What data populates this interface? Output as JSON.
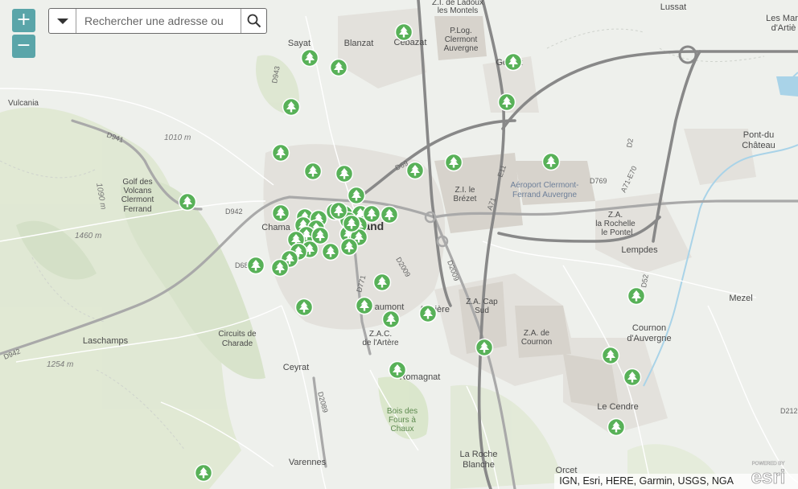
{
  "search": {
    "placeholder": "Rechercher une adresse ou"
  },
  "zoom": {
    "in_label": "+",
    "out_label": "−"
  },
  "attribution": "IGN, Esri, HERE, Garmin, USGS, NGA",
  "logo": {
    "powered_by": "POWERED BY",
    "brand": "esri"
  },
  "places": {
    "lussat": "Lussat",
    "les_martres_1": "Les Mar",
    "les_martres_2": "d'Artiè",
    "za_ladoux_1": "Z.I. de Ladoux",
    "za_ladoux_2": "les Montels",
    "plog_1": "P.Log.",
    "plog_2": "Clermont",
    "plog_3": "Auvergne",
    "sayat": "Sayat",
    "blanzat": "Blanzat",
    "cebazat": "Cébazat",
    "gerzat": "Gerzat",
    "vulcania": "Vulcania",
    "pont_chateau_1": "Pont-du",
    "pont_chateau_2": "Château",
    "golf_1": "Golf des",
    "golf_2": "Volcans",
    "golf_3": "Clermont",
    "golf_4": "Ferrand",
    "zi_brezet_1": "Z.I. le",
    "zi_brezet_2": "Brézet",
    "aero_1": "Aéroport Clermont-",
    "aero_2": "Ferrand Auvergne",
    "za_rochelle_1": "Z.A.",
    "za_rochelle_2": "la Rochelle",
    "za_rochelle_3": "le Pontel",
    "chamalieres": "Chama",
    "clermont": "rand",
    "lempdes": "Lempdes",
    "mezel": "Mezel",
    "aubiere": "Aubière",
    "beaumont": "aumont",
    "za_cap_1": "Z.A. Cap",
    "za_cap_2": "Sud",
    "za_cournon_1": "Z.A. de",
    "za_cournon_2": "Cournon",
    "cournon_1": "Cournon",
    "cournon_2": "d'Auvergne",
    "laschamps": "Laschamps",
    "charade_1": "Circuits de",
    "charade_2": "Charade",
    "zac_artiere_1": "Z.A.C.",
    "zac_artiere_2": "de l'Artère",
    "ceyrat": "Ceyrat",
    "romagnat": "Romagnat",
    "bois_1": "Bois des",
    "bois_2": "Fours à",
    "bois_3": "Chaux",
    "le_cendre": "Le Cendre",
    "varennes": "Varennes",
    "la_roche_1": "La Roche",
    "la_roche_2": "Blanche",
    "orcet": "Orcet"
  },
  "roads": {
    "d941": "D941",
    "d942a": "D942",
    "d942b": "D942",
    "d943": "D943",
    "d69": "D69",
    "d2009a": "D2009",
    "d2009b": "D2009",
    "d2089": "D2089",
    "a71": "A71",
    "a71e": "A71-E70",
    "e11": "E11",
    "d2": "D2",
    "d769": "D769",
    "d52": "D52",
    "d212": "D212",
    "d68": "D68",
    "d771": "D771"
  },
  "elevations": {
    "e1010": "1010 m",
    "e1460": "1460 m",
    "e1254": "1254 m",
    "e1090": "1090 m"
  },
  "markers": {
    "icon": "tree-icon",
    "color": "#58b158",
    "count": 52
  }
}
